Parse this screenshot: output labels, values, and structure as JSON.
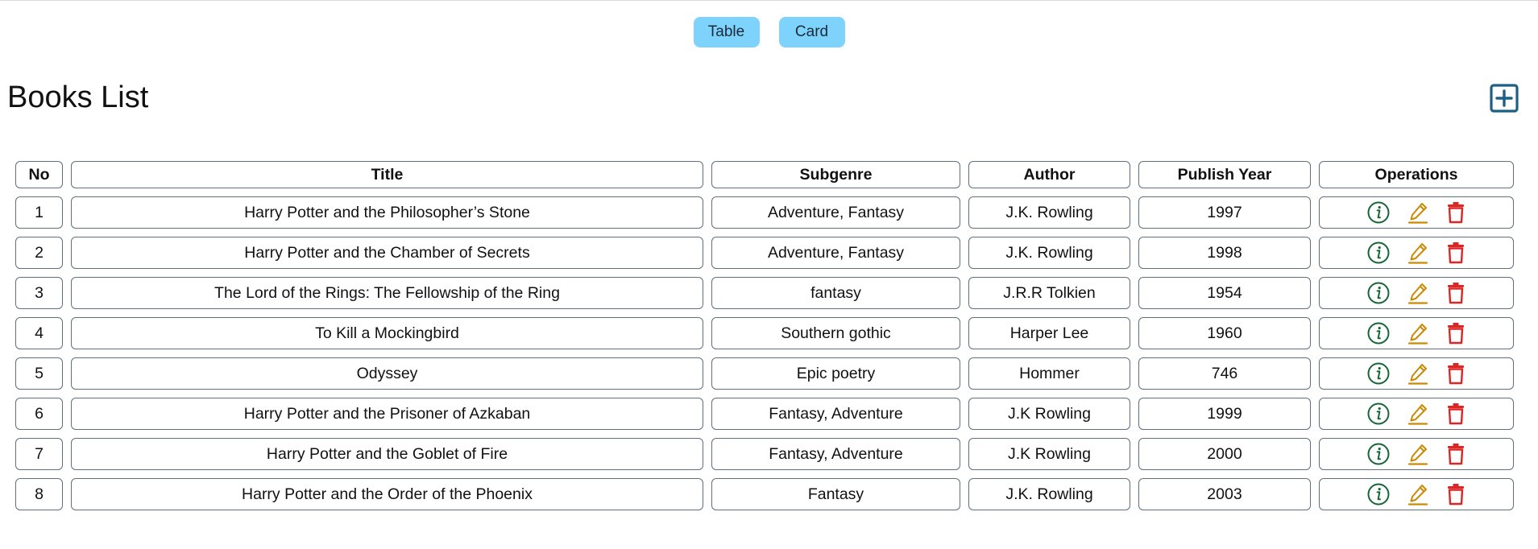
{
  "view_toggle": {
    "table_label": "Table",
    "card_label": "Card",
    "button_color": "#7dd3fc"
  },
  "header": {
    "title": "Books List",
    "add_icon": "plus-square-icon",
    "add_icon_color": "#1e5f85"
  },
  "table": {
    "columns": [
      "No",
      "Title",
      "Subgenre",
      "Author",
      "Publish Year",
      "Operations"
    ],
    "operation_icons": [
      {
        "name": "info-icon",
        "color": "#166534"
      },
      {
        "name": "edit-icon",
        "color": "#ca8a04"
      },
      {
        "name": "delete-icon",
        "color": "#dc2626"
      }
    ],
    "rows": [
      {
        "no": "1",
        "title": "Harry Potter and the Philosopher’s Stone",
        "subgenre": "Adventure, Fantasy",
        "author": "J.K. Rowling",
        "year": "1997"
      },
      {
        "no": "2",
        "title": "Harry Potter and the Chamber of Secrets",
        "subgenre": "Adventure, Fantasy",
        "author": "J.K. Rowling",
        "year": "1998"
      },
      {
        "no": "3",
        "title": "The Lord of the Rings: The Fellowship of the Ring",
        "subgenre": "fantasy",
        "author": "J.R.R Tolkien",
        "year": "1954"
      },
      {
        "no": "4",
        "title": "To Kill a Mockingbird",
        "subgenre": "Southern gothic",
        "author": "Harper Lee",
        "year": "1960"
      },
      {
        "no": "5",
        "title": "Odyssey",
        "subgenre": "Epic poetry",
        "author": "Hommer",
        "year": "746"
      },
      {
        "no": "6",
        "title": "Harry Potter and the Prisoner of Azkaban",
        "subgenre": "Fantasy, Adventure",
        "author": "J.K Rowling",
        "year": "1999"
      },
      {
        "no": "7",
        "title": "Harry Potter and the Goblet of Fire",
        "subgenre": "Fantasy, Adventure",
        "author": "J.K Rowling",
        "year": "2000"
      },
      {
        "no": "8",
        "title": "Harry Potter and the Order of the Phoenix",
        "subgenre": "Fantasy",
        "author": "J.K. Rowling",
        "year": "2003"
      }
    ]
  }
}
